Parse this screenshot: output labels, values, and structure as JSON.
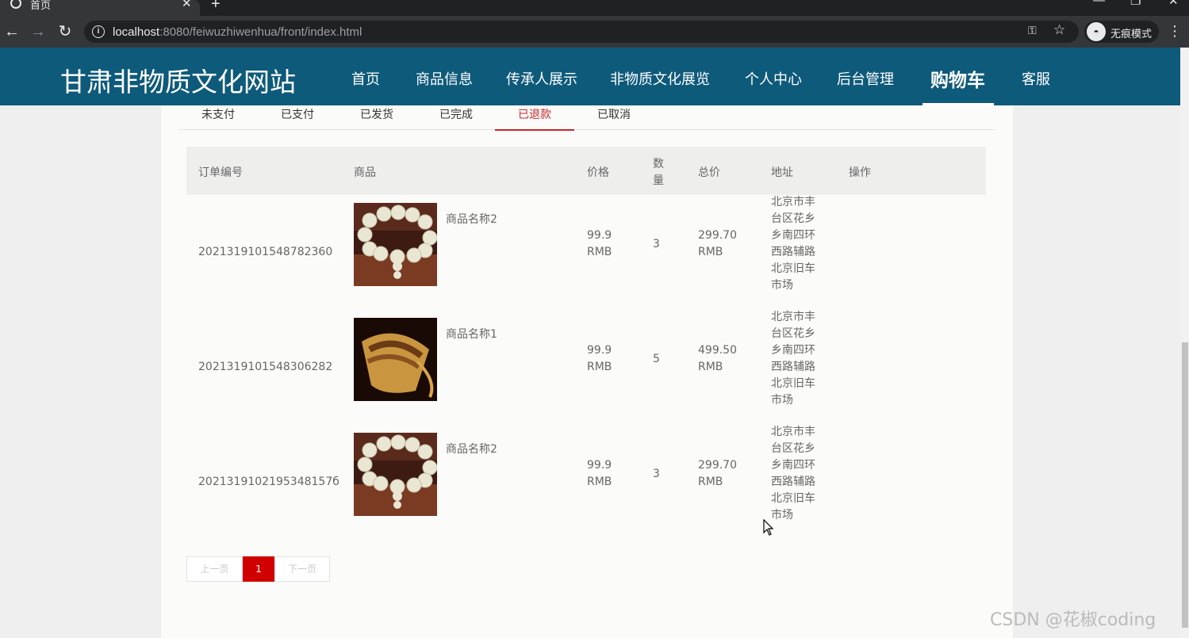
{
  "browser": {
    "tab_title": "首页",
    "tab_close": "✕",
    "new_tab": "+",
    "url_host": "localhost",
    "url_rest": ":8080/feiwuzhiwenhua/front/index.html",
    "incognito_label": "无痕模式",
    "back": "←",
    "forward": "→",
    "reload": "↻",
    "key": "⚿",
    "star": "☆",
    "menu": "⋮",
    "minimize": "—",
    "maximize": "❐",
    "close": "✕"
  },
  "site": {
    "logo": "甘肃非物质文化网站",
    "nav": [
      "首页",
      "商品信息",
      "传承人展示",
      "非物质文化展览",
      "个人中心",
      "后台管理",
      "购物车",
      "客服"
    ],
    "active_nav": "购物车"
  },
  "order_tabs": [
    "未支付",
    "已支付",
    "已发货",
    "已完成",
    "已退款",
    "已取消"
  ],
  "active_order_tab": "已退款",
  "table": {
    "headers": {
      "order_no": "订单编号",
      "product": "商品",
      "price": "价格",
      "qty_1": "数",
      "qty_2": "量",
      "total": "总价",
      "address": "地址",
      "action": "操作"
    },
    "rows": [
      {
        "order_no": "2021319101548782360",
        "product_name": "商品名称2",
        "image": "beads",
        "price": "99.9",
        "price_unit": "RMB",
        "qty": "3",
        "total": "299.70",
        "total_unit": "RMB",
        "address": [
          "北京市丰",
          "台区花乡",
          "乡南四环",
          "西路辅路",
          "北京旧车",
          "市场"
        ]
      },
      {
        "order_no": "2021319101548306282",
        "product_name": "商品名称1",
        "image": "basket",
        "price": "99.9",
        "price_unit": "RMB",
        "qty": "5",
        "total": "499.50",
        "total_unit": "RMB",
        "address": [
          "北京市丰",
          "台区花乡",
          "乡南四环",
          "西路辅路",
          "北京旧车",
          "市场"
        ]
      },
      {
        "order_no": "2021319102195348157б",
        "product_name": "商品名称2",
        "image": "beads",
        "price": "99.9",
        "price_unit": "RMB",
        "qty": "3",
        "total": "299.70",
        "total_unit": "RMB",
        "address": [
          "北京市丰",
          "台区花乡",
          "乡南四环",
          "西路辅路",
          "北京旧车",
          "市场"
        ]
      }
    ]
  },
  "pager": {
    "prev": "上一页",
    "current": "1",
    "next": "下一页"
  },
  "watermark": "CSDN @花椒coding",
  "colors": {
    "header_bg": "#0e5a7a",
    "accent_red": "#c6282b",
    "pager_active": "#d10000"
  }
}
